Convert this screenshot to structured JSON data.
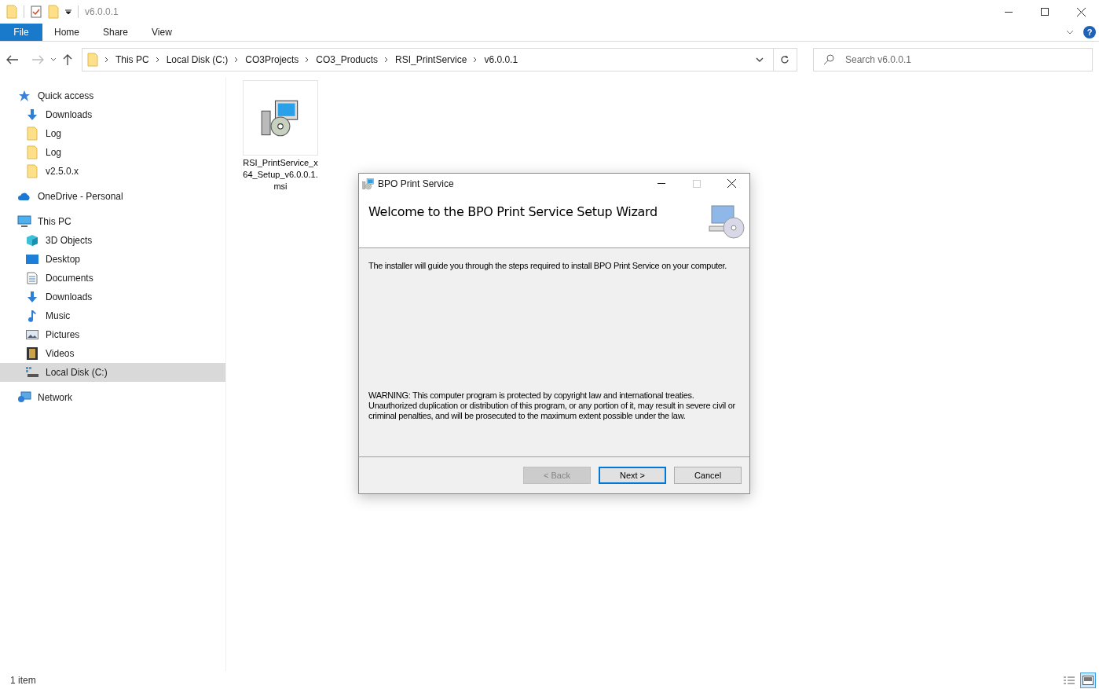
{
  "window": {
    "title": "v6.0.0.1"
  },
  "ribbon_tabs": [
    {
      "label": "File",
      "selected": true
    },
    {
      "label": "Home",
      "selected": false
    },
    {
      "label": "Share",
      "selected": false
    },
    {
      "label": "View",
      "selected": false
    }
  ],
  "breadcrumb": [
    "This PC",
    "Local Disk (C:)",
    "CO3Projects",
    "CO3_Products",
    "RSI_PrintService",
    "v6.0.0.1"
  ],
  "search": {
    "placeholder": "Search v6.0.0.1"
  },
  "help": {
    "label": "?"
  },
  "sidebar": [
    {
      "label": "Quick access",
      "kind": "star",
      "selected": false,
      "children": [
        {
          "label": "Downloads",
          "kind": "download",
          "selected": false
        },
        {
          "label": "Log",
          "kind": "folder",
          "selected": false
        },
        {
          "label": "Log",
          "kind": "folder",
          "selected": false
        },
        {
          "label": "v2.5.0.x",
          "kind": "folder",
          "selected": false
        }
      ]
    },
    {
      "label": "OneDrive - Personal",
      "kind": "cloud",
      "selected": false
    },
    {
      "label": "This PC",
      "kind": "pc",
      "selected": false,
      "children": [
        {
          "label": "3D Objects",
          "kind": "cube",
          "selected": false
        },
        {
          "label": "Desktop",
          "kind": "desktop",
          "selected": false
        },
        {
          "label": "Documents",
          "kind": "document",
          "selected": false
        },
        {
          "label": "Downloads",
          "kind": "download",
          "selected": false
        },
        {
          "label": "Music",
          "kind": "music",
          "selected": false
        },
        {
          "label": "Pictures",
          "kind": "picture",
          "selected": false
        },
        {
          "label": "Videos",
          "kind": "video",
          "selected": false
        },
        {
          "label": "Local Disk (C:)",
          "kind": "disk",
          "selected": true
        }
      ]
    },
    {
      "label": "Network",
      "kind": "network",
      "selected": false
    }
  ],
  "files": [
    {
      "name": "RSI_PrintService_x64_Setup_v6.0.0.1.msi"
    }
  ],
  "status_bar": {
    "count": "1 item",
    "views": [
      {
        "kind": "details",
        "selected": false
      },
      {
        "kind": "large",
        "selected": true
      }
    ]
  },
  "dialog": {
    "title": "BPO Print Service",
    "heading": "Welcome to the BPO Print Service Setup Wizard",
    "intro": "The installer will guide you through the steps required to install BPO Print Service on your computer.",
    "warning": "WARNING: This computer program is protected by copyright law and international treaties. Unauthorized duplication or distribution of this program, or any portion of it, may result in severe civil or criminal penalties, and will be prosecuted to the maximum extent possible under the law.",
    "buttons": [
      {
        "label": "< Back",
        "disabled": true,
        "default": false
      },
      {
        "label": "Next >",
        "disabled": false,
        "default": true
      },
      {
        "label": "Cancel",
        "disabled": false,
        "default": false
      }
    ]
  }
}
